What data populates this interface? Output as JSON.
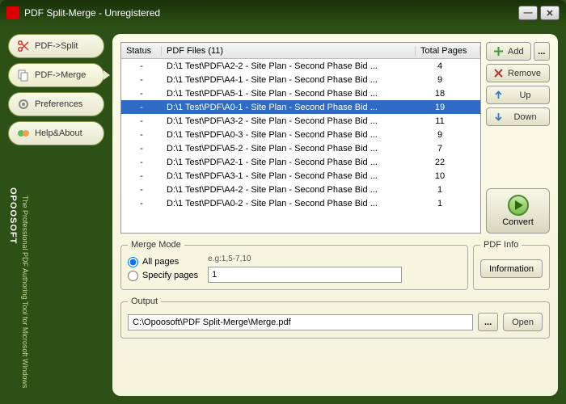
{
  "title": "PDF Split-Merge - Unregistered",
  "sidebar": {
    "split": "PDF->Split",
    "merge": "PDF->Merge",
    "prefs": "Preferences",
    "help": "Help&About"
  },
  "tagline": "The Professional PDF Authoring Tool for Microsoft Windows",
  "brand": "OPOOSOFT",
  "table": {
    "col_status": "Status",
    "col_files": "PDF Files (11)",
    "col_pages": "Total Pages",
    "rows": [
      {
        "status": "-",
        "file": "D:\\1 Test\\PDF\\A2-2 - Site Plan - Second Phase Bid ...",
        "pages": "4",
        "sel": false
      },
      {
        "status": "-",
        "file": "D:\\1 Test\\PDF\\A4-1 - Site Plan - Second Phase Bid ...",
        "pages": "9",
        "sel": false
      },
      {
        "status": "-",
        "file": "D:\\1 Test\\PDF\\A5-1 - Site Plan - Second Phase Bid ...",
        "pages": "18",
        "sel": false
      },
      {
        "status": "-",
        "file": "D:\\1 Test\\PDF\\A0-1 - Site Plan - Second Phase Bid ...",
        "pages": "19",
        "sel": true
      },
      {
        "status": "-",
        "file": "D:\\1 Test\\PDF\\A3-2 - Site Plan - Second Phase Bid ...",
        "pages": "11",
        "sel": false
      },
      {
        "status": "-",
        "file": "D:\\1 Test\\PDF\\A0-3 - Site Plan - Second Phase Bid ...",
        "pages": "9",
        "sel": false
      },
      {
        "status": "-",
        "file": "D:\\1 Test\\PDF\\A5-2 - Site Plan - Second Phase Bid ...",
        "pages": "7",
        "sel": false
      },
      {
        "status": "-",
        "file": "D:\\1 Test\\PDF\\A2-1 - Site Plan - Second Phase Bid ...",
        "pages": "22",
        "sel": false
      },
      {
        "status": "-",
        "file": "D:\\1 Test\\PDF\\A3-1 - Site Plan - Second Phase Bid ...",
        "pages": "10",
        "sel": false
      },
      {
        "status": "-",
        "file": "D:\\1 Test\\PDF\\A4-2 - Site Plan - Second Phase Bid ...",
        "pages": "1",
        "sel": false
      },
      {
        "status": "-",
        "file": "D:\\1 Test\\PDF\\A0-2 - Site Plan - Second Phase Bid ...",
        "pages": "1",
        "sel": false
      }
    ]
  },
  "actions": {
    "add": "Add",
    "remove": "Remove",
    "up": "Up",
    "down": "Down",
    "convert": "Convert",
    "browse": "..."
  },
  "merge_mode": {
    "legend": "Merge Mode",
    "all": "All pages",
    "eg": "e.g:1,5-7,10",
    "specify": "Specify pages",
    "specify_value": "1"
  },
  "pdf_info": {
    "legend": "PDF Info",
    "button": "Information"
  },
  "output": {
    "legend": "Output",
    "path": "C:\\Opoosoft\\PDF Split-Merge\\Merge.pdf",
    "open": "Open",
    "browse": "..."
  }
}
